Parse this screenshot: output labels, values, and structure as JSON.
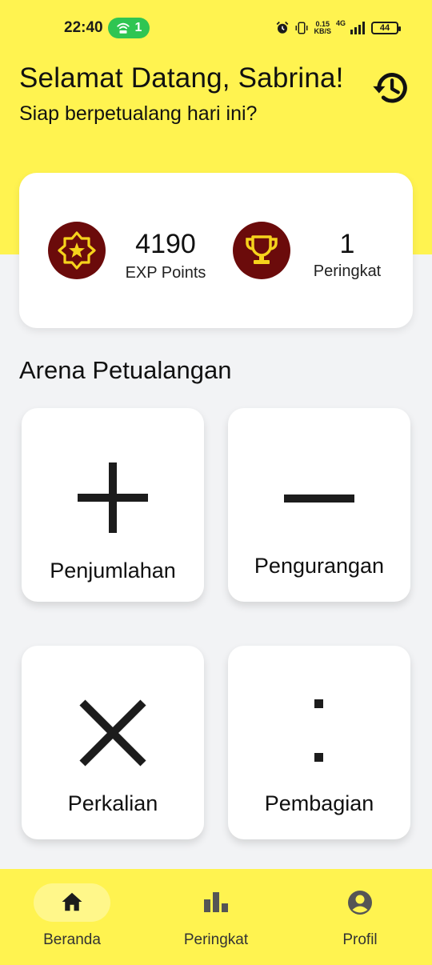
{
  "status_bar": {
    "time": "22:40",
    "hotspot_count": "1",
    "net_speed_value": "0.15",
    "net_speed_unit": "KB/S",
    "network": "4G",
    "battery": "44"
  },
  "header": {
    "greeting": "Selamat Datang, Sabrina!",
    "subtitle": "Siap berpetualang hari ini?",
    "history_icon": "history-icon"
  },
  "stats": {
    "exp": {
      "value": "4190",
      "label": "EXP Points",
      "icon": "star-badge-icon"
    },
    "rank": {
      "value": "1",
      "label": "Peringkat",
      "icon": "trophy-icon"
    }
  },
  "arena": {
    "title": "Arena Petualangan",
    "cards": [
      {
        "label": "Penjumlahan",
        "icon": "plus-icon"
      },
      {
        "label": "Pengurangan",
        "icon": "minus-icon"
      },
      {
        "label": "Perkalian",
        "icon": "multiply-icon"
      },
      {
        "label": "Pembagian",
        "icon": "divide-icon"
      }
    ]
  },
  "bottom_nav": {
    "items": [
      {
        "label": "Beranda",
        "icon": "home-icon",
        "active": true
      },
      {
        "label": "Peringkat",
        "icon": "bar-chart-icon",
        "active": false
      },
      {
        "label": "Profil",
        "icon": "profile-icon",
        "active": false
      }
    ]
  },
  "colors": {
    "brand_yellow": "#fff350",
    "accent_maroon": "#6b0b0b",
    "icon_gold": "#f6d31c",
    "hotspot_green": "#2fc552"
  }
}
